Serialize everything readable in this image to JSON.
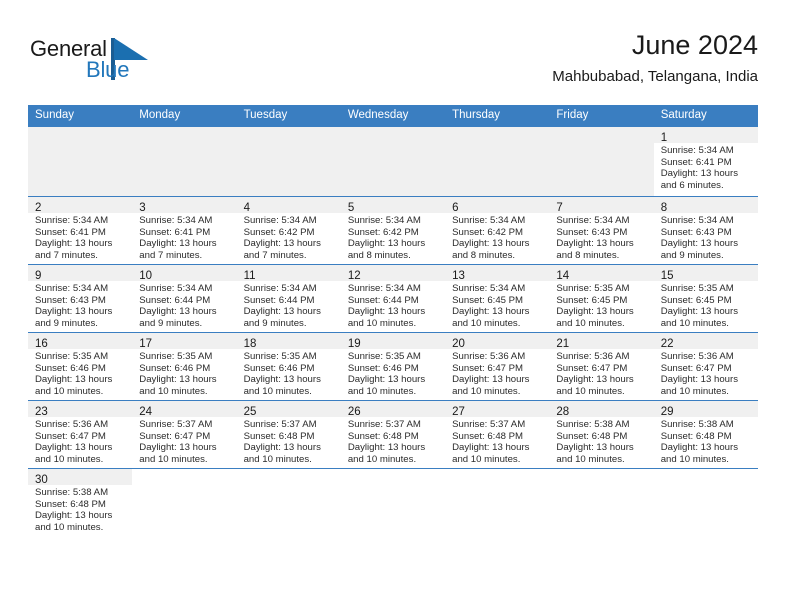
{
  "brand": {
    "name_top": "General",
    "name_bottom": "Blue",
    "flag_icon": "blue-flag-icon",
    "color_top": "#1a1a1a",
    "color_bottom": "#2277bb",
    "accent": "#1b5d93"
  },
  "header": {
    "title": "June 2024",
    "subtitle": "Mahbubabad, Telangana, India"
  },
  "theme": {
    "header_bg": "#3a7ec1",
    "header_text": "#ffffff",
    "daynum_band_bg": "#f0f0f0",
    "cell_bg": "#ffffff",
    "grid_line": "#3a7ec1"
  },
  "weekday_headers": [
    "Sunday",
    "Monday",
    "Tuesday",
    "Wednesday",
    "Thursday",
    "Friday",
    "Saturday"
  ],
  "weeks": [
    [
      {
        "empty": true
      },
      {
        "empty": true
      },
      {
        "empty": true
      },
      {
        "empty": true
      },
      {
        "empty": true
      },
      {
        "empty": true
      },
      {
        "day": "1",
        "sunrise": "Sunrise: 5:34 AM",
        "sunset": "Sunset: 6:41 PM",
        "daylight1": "Daylight: 13 hours",
        "daylight2": "and 6 minutes."
      }
    ],
    [
      {
        "day": "2",
        "sunrise": "Sunrise: 5:34 AM",
        "sunset": "Sunset: 6:41 PM",
        "daylight1": "Daylight: 13 hours",
        "daylight2": "and 7 minutes."
      },
      {
        "day": "3",
        "sunrise": "Sunrise: 5:34 AM",
        "sunset": "Sunset: 6:41 PM",
        "daylight1": "Daylight: 13 hours",
        "daylight2": "and 7 minutes."
      },
      {
        "day": "4",
        "sunrise": "Sunrise: 5:34 AM",
        "sunset": "Sunset: 6:42 PM",
        "daylight1": "Daylight: 13 hours",
        "daylight2": "and 7 minutes."
      },
      {
        "day": "5",
        "sunrise": "Sunrise: 5:34 AM",
        "sunset": "Sunset: 6:42 PM",
        "daylight1": "Daylight: 13 hours",
        "daylight2": "and 8 minutes."
      },
      {
        "day": "6",
        "sunrise": "Sunrise: 5:34 AM",
        "sunset": "Sunset: 6:42 PM",
        "daylight1": "Daylight: 13 hours",
        "daylight2": "and 8 minutes."
      },
      {
        "day": "7",
        "sunrise": "Sunrise: 5:34 AM",
        "sunset": "Sunset: 6:43 PM",
        "daylight1": "Daylight: 13 hours",
        "daylight2": "and 8 minutes."
      },
      {
        "day": "8",
        "sunrise": "Sunrise: 5:34 AM",
        "sunset": "Sunset: 6:43 PM",
        "daylight1": "Daylight: 13 hours",
        "daylight2": "and 9 minutes."
      }
    ],
    [
      {
        "day": "9",
        "sunrise": "Sunrise: 5:34 AM",
        "sunset": "Sunset: 6:43 PM",
        "daylight1": "Daylight: 13 hours",
        "daylight2": "and 9 minutes."
      },
      {
        "day": "10",
        "sunrise": "Sunrise: 5:34 AM",
        "sunset": "Sunset: 6:44 PM",
        "daylight1": "Daylight: 13 hours",
        "daylight2": "and 9 minutes."
      },
      {
        "day": "11",
        "sunrise": "Sunrise: 5:34 AM",
        "sunset": "Sunset: 6:44 PM",
        "daylight1": "Daylight: 13 hours",
        "daylight2": "and 9 minutes."
      },
      {
        "day": "12",
        "sunrise": "Sunrise: 5:34 AM",
        "sunset": "Sunset: 6:44 PM",
        "daylight1": "Daylight: 13 hours",
        "daylight2": "and 10 minutes."
      },
      {
        "day": "13",
        "sunrise": "Sunrise: 5:34 AM",
        "sunset": "Sunset: 6:45 PM",
        "daylight1": "Daylight: 13 hours",
        "daylight2": "and 10 minutes."
      },
      {
        "day": "14",
        "sunrise": "Sunrise: 5:35 AM",
        "sunset": "Sunset: 6:45 PM",
        "daylight1": "Daylight: 13 hours",
        "daylight2": "and 10 minutes."
      },
      {
        "day": "15",
        "sunrise": "Sunrise: 5:35 AM",
        "sunset": "Sunset: 6:45 PM",
        "daylight1": "Daylight: 13 hours",
        "daylight2": "and 10 minutes."
      }
    ],
    [
      {
        "day": "16",
        "sunrise": "Sunrise: 5:35 AM",
        "sunset": "Sunset: 6:46 PM",
        "daylight1": "Daylight: 13 hours",
        "daylight2": "and 10 minutes."
      },
      {
        "day": "17",
        "sunrise": "Sunrise: 5:35 AM",
        "sunset": "Sunset: 6:46 PM",
        "daylight1": "Daylight: 13 hours",
        "daylight2": "and 10 minutes."
      },
      {
        "day": "18",
        "sunrise": "Sunrise: 5:35 AM",
        "sunset": "Sunset: 6:46 PM",
        "daylight1": "Daylight: 13 hours",
        "daylight2": "and 10 minutes."
      },
      {
        "day": "19",
        "sunrise": "Sunrise: 5:35 AM",
        "sunset": "Sunset: 6:46 PM",
        "daylight1": "Daylight: 13 hours",
        "daylight2": "and 10 minutes."
      },
      {
        "day": "20",
        "sunrise": "Sunrise: 5:36 AM",
        "sunset": "Sunset: 6:47 PM",
        "daylight1": "Daylight: 13 hours",
        "daylight2": "and 10 minutes."
      },
      {
        "day": "21",
        "sunrise": "Sunrise: 5:36 AM",
        "sunset": "Sunset: 6:47 PM",
        "daylight1": "Daylight: 13 hours",
        "daylight2": "and 10 minutes."
      },
      {
        "day": "22",
        "sunrise": "Sunrise: 5:36 AM",
        "sunset": "Sunset: 6:47 PM",
        "daylight1": "Daylight: 13 hours",
        "daylight2": "and 10 minutes."
      }
    ],
    [
      {
        "day": "23",
        "sunrise": "Sunrise: 5:36 AM",
        "sunset": "Sunset: 6:47 PM",
        "daylight1": "Daylight: 13 hours",
        "daylight2": "and 10 minutes."
      },
      {
        "day": "24",
        "sunrise": "Sunrise: 5:37 AM",
        "sunset": "Sunset: 6:47 PM",
        "daylight1": "Daylight: 13 hours",
        "daylight2": "and 10 minutes."
      },
      {
        "day": "25",
        "sunrise": "Sunrise: 5:37 AM",
        "sunset": "Sunset: 6:48 PM",
        "daylight1": "Daylight: 13 hours",
        "daylight2": "and 10 minutes."
      },
      {
        "day": "26",
        "sunrise": "Sunrise: 5:37 AM",
        "sunset": "Sunset: 6:48 PM",
        "daylight1": "Daylight: 13 hours",
        "daylight2": "and 10 minutes."
      },
      {
        "day": "27",
        "sunrise": "Sunrise: 5:37 AM",
        "sunset": "Sunset: 6:48 PM",
        "daylight1": "Daylight: 13 hours",
        "daylight2": "and 10 minutes."
      },
      {
        "day": "28",
        "sunrise": "Sunrise: 5:38 AM",
        "sunset": "Sunset: 6:48 PM",
        "daylight1": "Daylight: 13 hours",
        "daylight2": "and 10 minutes."
      },
      {
        "day": "29",
        "sunrise": "Sunrise: 5:38 AM",
        "sunset": "Sunset: 6:48 PM",
        "daylight1": "Daylight: 13 hours",
        "daylight2": "and 10 minutes."
      }
    ],
    [
      {
        "day": "30",
        "sunrise": "Sunrise: 5:38 AM",
        "sunset": "Sunset: 6:48 PM",
        "daylight1": "Daylight: 13 hours",
        "daylight2": "and 10 minutes."
      },
      {
        "blank": true
      },
      {
        "blank": true
      },
      {
        "blank": true
      },
      {
        "blank": true
      },
      {
        "blank": true
      },
      {
        "blank": true
      }
    ]
  ]
}
